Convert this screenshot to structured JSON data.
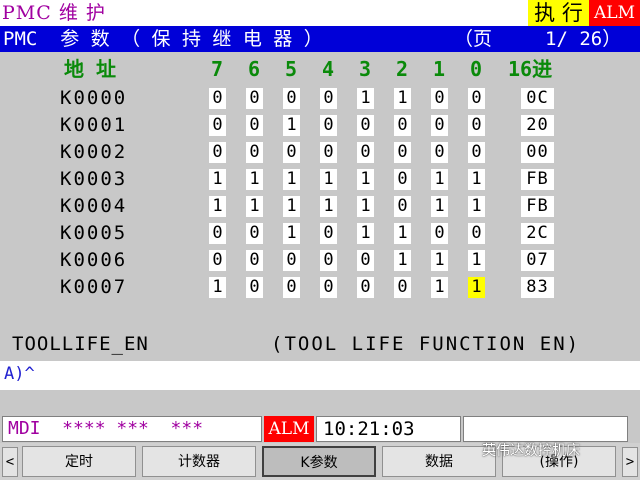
{
  "header": {
    "title": "PMC 维 护",
    "exec_label": "执 行",
    "alm_label": "ALM"
  },
  "title_bar": {
    "left": "PMC  参 数 （ 保 持 继 电 器 ）",
    "page_label": "（页",
    "page_value": "1/ 26）"
  },
  "table": {
    "addr_header": "地 址",
    "bit_headers": [
      "7",
      "6",
      "5",
      "4",
      "3",
      "2",
      "1",
      "0"
    ],
    "hex_header": "16进",
    "rows": [
      {
        "addr": "K0000",
        "bits": [
          "0",
          "0",
          "0",
          "0",
          "1",
          "1",
          "0",
          "0"
        ],
        "hex": "0C"
      },
      {
        "addr": "K0001",
        "bits": [
          "0",
          "0",
          "1",
          "0",
          "0",
          "0",
          "0",
          "0"
        ],
        "hex": "20"
      },
      {
        "addr": "K0002",
        "bits": [
          "0",
          "0",
          "0",
          "0",
          "0",
          "0",
          "0",
          "0"
        ],
        "hex": "00"
      },
      {
        "addr": "K0003",
        "bits": [
          "1",
          "1",
          "1",
          "1",
          "1",
          "0",
          "1",
          "1"
        ],
        "hex": "FB"
      },
      {
        "addr": "K0004",
        "bits": [
          "1",
          "1",
          "1",
          "1",
          "1",
          "0",
          "1",
          "1"
        ],
        "hex": "FB"
      },
      {
        "addr": "K0005",
        "bits": [
          "0",
          "0",
          "1",
          "0",
          "1",
          "1",
          "0",
          "0"
        ],
        "hex": "2C"
      },
      {
        "addr": "K0006",
        "bits": [
          "0",
          "0",
          "0",
          "0",
          "0",
          "1",
          "1",
          "1"
        ],
        "hex": "07"
      },
      {
        "addr": "K0007",
        "bits": [
          "1",
          "0",
          "0",
          "0",
          "0",
          "0",
          "1",
          "1"
        ],
        "hex": "83"
      }
    ],
    "selected": {
      "row": "K0007",
      "bit": "0"
    }
  },
  "description": {
    "symbol": "TOOLLIFE_EN",
    "comment": "(TOOL LIFE FUNCTION EN)"
  },
  "input_line": {
    "text": "A)^"
  },
  "status_bar": {
    "mode": "MDI  **** ***  ***",
    "alm": "ALM",
    "time": "10:21:03"
  },
  "softkeys": {
    "left_arrow": "<",
    "right_arrow": ">",
    "items": [
      "定时",
      "计数器",
      "K参数",
      "数据",
      "(操作)"
    ]
  },
  "watermark": "英伟达数控机床",
  "colors": {
    "title_bar_bg": "#0000d8",
    "panel_bg": "#c8c8c8",
    "header_green": "#0a8a0a",
    "mode_text": "#a000a0",
    "alarm_red": "#ff0000",
    "exec_yellow": "#ffff00",
    "selection": "#ffff00"
  }
}
